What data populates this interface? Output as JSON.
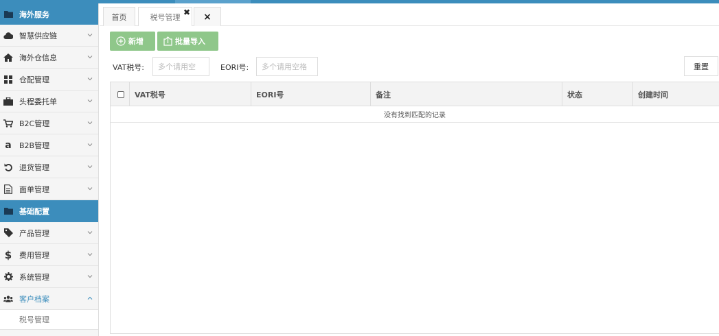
{
  "sidebar": {
    "sections": [
      {
        "label": "海外服务",
        "icon": "folder-icon"
      },
      {
        "label": "基础配置",
        "icon": "folder-icon"
      }
    ],
    "group1": [
      {
        "label": "智慧供应链",
        "icon": "cloud-icon"
      },
      {
        "label": "海外仓信息",
        "icon": "home-icon"
      },
      {
        "label": "仓配管理",
        "icon": "grid-icon"
      },
      {
        "label": "头程委托单",
        "icon": "briefcase-icon"
      },
      {
        "label": "B2C管理",
        "icon": "cart-icon"
      },
      {
        "label": "B2B管理",
        "icon": "amazon-icon"
      },
      {
        "label": "退货管理",
        "icon": "undo-icon"
      },
      {
        "label": "面单管理",
        "icon": "document-icon"
      }
    ],
    "group2": [
      {
        "label": "产品管理",
        "icon": "tag-icon"
      },
      {
        "label": "费用管理",
        "icon": "dollar-icon"
      },
      {
        "label": "系统管理",
        "icon": "gear-icon"
      },
      {
        "label": "客户档案",
        "icon": "users-icon"
      }
    ],
    "sub_item": "税号管理"
  },
  "tabs": [
    {
      "label": "首页"
    },
    {
      "label": "税号管理"
    }
  ],
  "tab_close_all": "×",
  "toolbar": {
    "add_label": "新增",
    "import_label": "批量导入"
  },
  "search": {
    "vat_label": "VAT税号:",
    "vat_placeholder": "多个请用空",
    "eori_label": "EORI号:",
    "eori_placeholder": "多个请用空格",
    "reset_label": "重置"
  },
  "table": {
    "columns": [
      "VAT税号",
      "EORI号",
      "备注",
      "状态",
      "创建时间"
    ],
    "empty_message": "没有找到匹配的记录"
  },
  "colors": {
    "primary": "#3c8dbc",
    "green_button": "#8fc78a"
  }
}
